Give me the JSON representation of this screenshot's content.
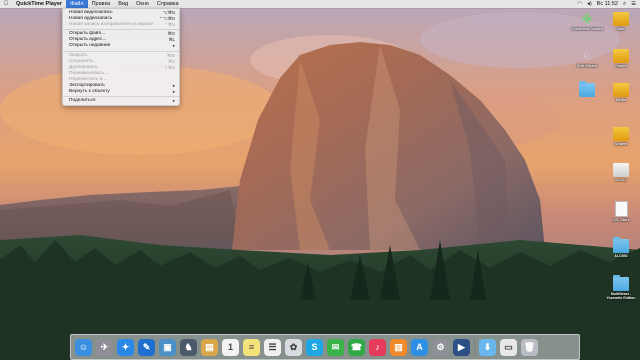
{
  "menubar": {
    "apple": "",
    "app_name": "QuickTime Player",
    "menus": [
      "Файл",
      "Правка",
      "Вид",
      "Окно",
      "Справка"
    ],
    "active_menu": "Файл",
    "status": {
      "clock": "Вс 11:52"
    }
  },
  "file_menu": {
    "items": [
      {
        "label": "Новая видеозапись",
        "shortcut": "⌥⌘N",
        "enabled": true
      },
      {
        "label": "Новая аудиозапись",
        "shortcut": "⌃⌥⌘N",
        "enabled": true
      },
      {
        "label": "Новая запись изображения на экране",
        "shortcut": "⌃⌘N",
        "enabled": false
      },
      {
        "separator": true
      },
      {
        "label": "Открыть файл...",
        "shortcut": "⌘O",
        "enabled": true
      },
      {
        "label": "Открыть адрес...",
        "shortcut": "⌘L",
        "enabled": true
      },
      {
        "label": "Открыть недавние",
        "shortcut": "▸",
        "enabled": true
      },
      {
        "separator": true
      },
      {
        "label": "Закрыть",
        "shortcut": "⌘W",
        "enabled": false
      },
      {
        "label": "Сохранить...",
        "shortcut": "⌘S",
        "enabled": false
      },
      {
        "label": "Дублировать",
        "shortcut": "⇧⌘S",
        "enabled": false
      },
      {
        "label": "Переименовать...",
        "shortcut": "",
        "enabled": false
      },
      {
        "label": "Переместить в...",
        "shortcut": "",
        "enabled": false
      },
      {
        "label": "Экспортировать",
        "shortcut": "▸",
        "enabled": true
      },
      {
        "label": "Вернуть к объекту",
        "shortcut": "▸",
        "enabled": true
      },
      {
        "separator": true
      },
      {
        "label": "Поделиться",
        "shortcut": "▸",
        "enabled": true
      }
    ]
  },
  "desktop_icons": [
    {
      "label": "Chameleon Wizard",
      "icon": "clover-icon"
    },
    {
      "label": "Mac",
      "icon": "yellow-drive-icon"
    },
    {
      "label": "Kext Wizard",
      "icon": "unicorn-icon"
    },
    {
      "label": "Games",
      "icon": "yellow-drive-icon"
    },
    {
      "label": "",
      "icon": "folder-icon"
    },
    {
      "label": "Media",
      "icon": "yellow-drive-icon"
    },
    {
      "label": "System",
      "icon": "yellow-drive-icon"
    },
    {
      "label": "10.10.1",
      "icon": "white-drive-icon"
    },
    {
      "label": ".DS_Store",
      "icon": "document-icon"
    },
    {
      "label": "ALC892",
      "icon": "folder-icon"
    },
    {
      "label": "MultiBeast - Yosemite Edition",
      "icon": "folder-icon"
    }
  ],
  "dock": {
    "apps": [
      {
        "name": "finder-icon",
        "color": "#3b8fe0",
        "glyph": "☺"
      },
      {
        "name": "launchpad-icon",
        "color": "#8e8e96",
        "glyph": "✈"
      },
      {
        "name": "safari-icon",
        "color": "#2a89e6",
        "glyph": "✦"
      },
      {
        "name": "xcode-icon",
        "color": "#1f6fcf",
        "glyph": "✎"
      },
      {
        "name": "preview-icon",
        "color": "#4a90c6",
        "glyph": "▣"
      },
      {
        "name": "game-icon",
        "color": "#4a5a6a",
        "glyph": "♞"
      },
      {
        "name": "notes-icon",
        "color": "#d9a64a",
        "glyph": "▤"
      },
      {
        "name": "calendar-icon",
        "color": "#f3f3f3",
        "glyph": "1"
      },
      {
        "name": "stickies-icon",
        "color": "#f4e27a",
        "glyph": "≡"
      },
      {
        "name": "reminders-icon",
        "color": "#f0f0f0",
        "glyph": "☰"
      },
      {
        "name": "photos-icon",
        "color": "#d8dce0",
        "glyph": "✿"
      },
      {
        "name": "skype-icon",
        "color": "#1ea7e4",
        "glyph": "S"
      },
      {
        "name": "messages-icon",
        "color": "#3ab34a",
        "glyph": "✉"
      },
      {
        "name": "facetime-icon",
        "color": "#2fa845",
        "glyph": "☎"
      },
      {
        "name": "music-icon",
        "color": "#e53a5a",
        "glyph": "♪"
      },
      {
        "name": "ibooks-icon",
        "color": "#f08a2a",
        "glyph": "▥"
      },
      {
        "name": "appstore-icon",
        "color": "#2e8fe6",
        "glyph": "A"
      },
      {
        "name": "system-preferences-icon",
        "color": "#8e9196",
        "glyph": "⚙"
      },
      {
        "name": "quicktime-icon",
        "color": "#2c4f86",
        "glyph": "▶"
      },
      {
        "name": "downloads-folder-icon",
        "color": "#69b7ec",
        "glyph": "⬇"
      },
      {
        "name": "desktop-folder-icon",
        "color": "#e8e8e8",
        "glyph": "▭"
      },
      {
        "name": "trash-icon",
        "color": "#b9bcc2",
        "glyph": "🗑"
      }
    ]
  }
}
